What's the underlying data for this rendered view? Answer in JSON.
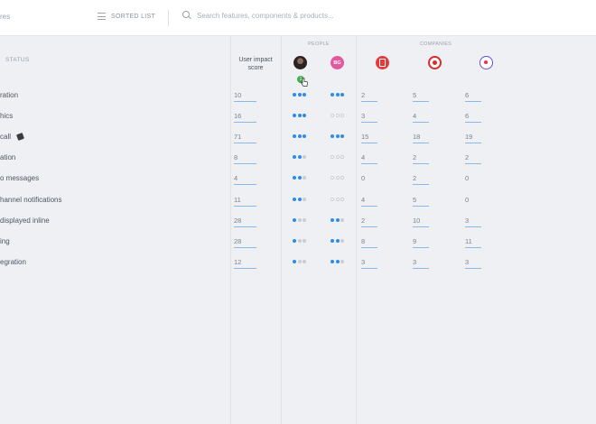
{
  "topbar": {
    "left_partial": "res",
    "sorted_list_label": "SORTED LIST",
    "search_placeholder": "Search features, components & products..."
  },
  "headers": {
    "status": "STATUS",
    "impact_line1": "User impact",
    "impact_line2": "score",
    "people": "PEOPLE",
    "companies": "COMPANIES",
    "person2_initials": "BG",
    "person1_badge": "1"
  },
  "features": [
    {
      "name": "ration",
      "score": "10",
      "p1": [
        "on",
        "on",
        "on"
      ],
      "p2": [
        "on",
        "on",
        "on"
      ],
      "c": [
        "2",
        "5",
        "6"
      ]
    },
    {
      "name": "hics",
      "score": "16",
      "p1": [
        "on",
        "on",
        "on"
      ],
      "p2": [
        "off",
        "off",
        "off"
      ],
      "c": [
        "3",
        "4",
        "6"
      ]
    },
    {
      "name": "call",
      "score": "71",
      "p1": [
        "on",
        "on",
        "on"
      ],
      "p2": [
        "on",
        "on",
        "on"
      ],
      "c": [
        "15",
        "18",
        "19"
      ],
      "has_phone": true
    },
    {
      "name": "ation",
      "score": "8",
      "p1": [
        "on",
        "on",
        "faint"
      ],
      "p2": [
        "off",
        "off",
        "off"
      ],
      "c": [
        "4",
        "2",
        "2"
      ]
    },
    {
      "name": "o messages",
      "score": "4",
      "p1": [
        "on",
        "on",
        "faint"
      ],
      "p2": [
        "off",
        "off",
        "off"
      ],
      "c": [
        "0",
        "2",
        "0"
      ],
      "plain": [
        true,
        false,
        true
      ]
    },
    {
      "name": "hannel notifications",
      "score": "11",
      "p1": [
        "on",
        "on",
        "faint"
      ],
      "p2": [
        "off",
        "off",
        "off"
      ],
      "c": [
        "4",
        "5",
        "0"
      ],
      "plain": [
        false,
        false,
        true
      ]
    },
    {
      "name": "displayed inline",
      "score": "28",
      "p1": [
        "on",
        "faint",
        "faint"
      ],
      "p2": [
        "on",
        "on",
        "faint"
      ],
      "c": [
        "2",
        "10",
        "3"
      ]
    },
    {
      "name": "ing",
      "score": "28",
      "p1": [
        "on",
        "faint",
        "faint"
      ],
      "p2": [
        "on",
        "on",
        "faint"
      ],
      "c": [
        "8",
        "9",
        "11"
      ]
    },
    {
      "name": "egration",
      "score": "12",
      "p1": [
        "on",
        "faint",
        "faint"
      ],
      "p2": [
        "on",
        "on",
        "faint"
      ],
      "c": [
        "3",
        "3",
        "3"
      ]
    }
  ]
}
